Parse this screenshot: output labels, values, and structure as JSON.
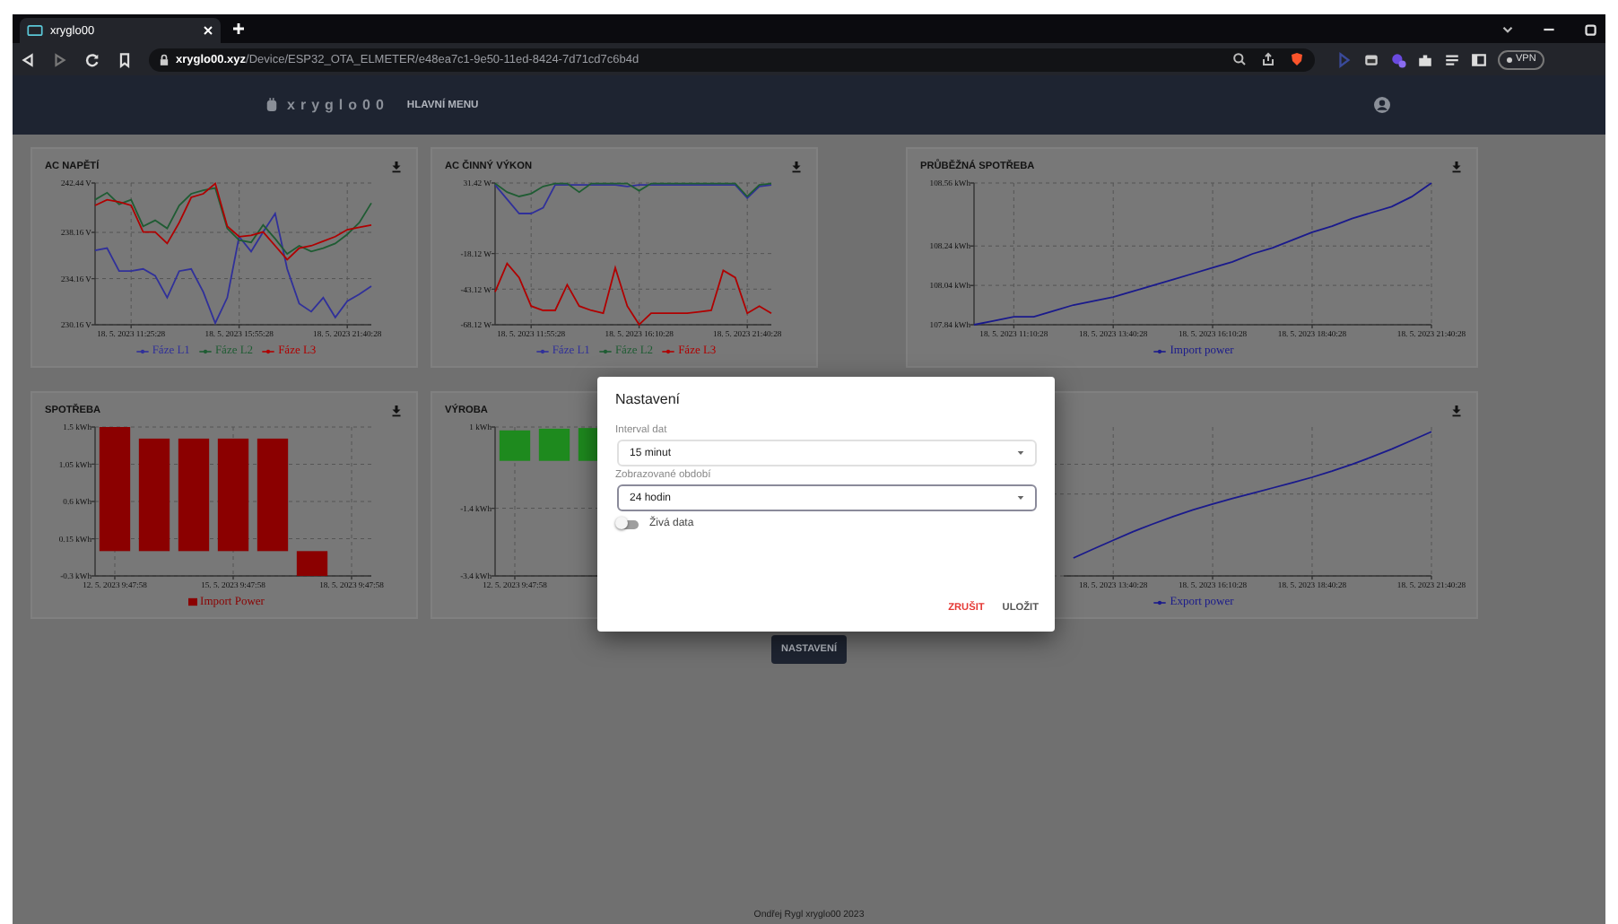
{
  "browser": {
    "tab_title": "xryglo00",
    "url_domain": "xryglo00.xyz",
    "url_path": "/Device/ESP32_OTA_ELMETER/e48ea7c1-9e50-11ed-8424-7d71cd7c6b4d",
    "vpn_label": "VPN"
  },
  "header": {
    "brand": "xryglo00",
    "menu": "HLAVNÍ MENU"
  },
  "cards": [
    {
      "title": "AC NAPĚTÍ",
      "download": true,
      "chart_data": {
        "type": "line",
        "grid": true,
        "ylim": [
          230.16,
          242.44
        ],
        "categories": [
          null,
          null,
          null,
          "18. 5. 2023 11:25:28",
          null,
          null,
          null,
          null,
          null,
          null,
          null,
          null,
          "18. 5. 2023 15:55:28",
          null,
          null,
          null,
          null,
          null,
          null,
          null,
          null,
          "18. 5. 2023 21:40:28",
          null,
          null
        ],
        "yticks": [
          {
            "value": 230.16,
            "label": "230.16 V"
          },
          {
            "value": 234.16,
            "label": "234.16 V"
          },
          {
            "value": 238.16,
            "label": "238.16 V"
          },
          {
            "value": 242.44,
            "label": "242.44 V"
          }
        ],
        "series": [
          {
            "name": "Fáze L1",
            "color": "#30309a",
            "values": [
              236.6,
              236.8,
              234.8,
              234.8,
              235,
              234.4,
              232.5,
              234.8,
              235,
              233,
              230.3,
              232.5,
              237.8,
              236.5,
              238.2,
              239.8,
              235,
              232,
              231.3,
              232.5,
              230.8,
              232.2,
              232.8,
              233.5
            ]
          },
          {
            "name": "Fáze L2",
            "color": "#1f5c33",
            "values": [
              241,
              241.6,
              240.6,
              241,
              238.7,
              239.2,
              238.5,
              240.5,
              241.5,
              241.8,
              242,
              238.5,
              237.5,
              237.3,
              238.8,
              237.6,
              236.3,
              237,
              236.5,
              236.8,
              237.2,
              238,
              239,
              240.7
            ]
          },
          {
            "name": "Fáze L3",
            "color": "#b00000",
            "values": [
              240.5,
              241,
              240.8,
              240.5,
              238.2,
              238.2,
              237.2,
              239,
              241.2,
              241.5,
              242.4,
              238.7,
              237.8,
              237.9,
              238.2,
              237,
              235.8,
              236.8,
              237,
              237.4,
              237.8,
              238.4,
              238.6,
              238.8
            ]
          }
        ]
      }
    },
    {
      "title": "AC ČINNÝ VÝKON",
      "download": true,
      "chart_data": {
        "type": "line",
        "grid": true,
        "ylim": [
          -68.12,
          31.42
        ],
        "categories": [
          null,
          null,
          null,
          "18. 5. 2023 11:55:28",
          null,
          null,
          null,
          null,
          null,
          null,
          null,
          null,
          "18. 5. 2023 16:10:28",
          null,
          null,
          null,
          null,
          null,
          null,
          null,
          null,
          "18. 5. 2023 21:40:28",
          null,
          null
        ],
        "yticks": [
          {
            "value": -68.12,
            "label": "-68.12 W"
          },
          {
            "value": -43.12,
            "label": "-43.12 W"
          },
          {
            "value": -18.12,
            "label": "-18.12 W"
          },
          {
            "value": 31.42,
            "label": "31.42 W"
          }
        ],
        "series": [
          {
            "name": "Fáze L1",
            "color": "#30309a",
            "values": [
              30,
              20,
              10,
              10,
              14,
              30,
              30,
              30,
              30,
              30,
              30,
              29,
              30,
              30,
              30,
              30,
              30,
              30,
              30,
              30,
              30,
              21,
              29,
              30
            ]
          },
          {
            "name": "Fáze L2",
            "color": "#1f5c33",
            "values": [
              31,
              25,
              22,
              24,
              29,
              31,
              31,
              25,
              31,
              31,
              31,
              31,
              26,
              31,
              31,
              31,
              31,
              31,
              31,
              31,
              31,
              22,
              30,
              31
            ]
          },
          {
            "name": "Fáze L3",
            "color": "#b00000",
            "values": [
              -45,
              -25,
              -35,
              -55,
              -58,
              -58,
              -40,
              -55,
              -58,
              -60,
              -28,
              -55,
              -68,
              -60,
              -60,
              -60,
              -60,
              -59,
              -58,
              -30,
              -35,
              -60,
              -55,
              -60
            ]
          }
        ]
      }
    },
    {
      "title": "PRŮBĚŽNÁ SPOTŘEBA",
      "download": true,
      "chart_data": {
        "type": "line",
        "grid": true,
        "ylim": [
          107.84,
          108.56
        ],
        "categories": [
          null,
          null,
          "18. 5. 2023 11:10:28",
          null,
          null,
          null,
          null,
          "18. 5. 2023 13:40:28",
          null,
          null,
          null,
          null,
          "18. 5. 2023 16:10:28",
          null,
          null,
          null,
          null,
          "18. 5. 2023 18:40:28",
          null,
          null,
          null,
          null,
          null,
          "18. 5. 2023 21:40:28"
        ],
        "yticks": [
          {
            "value": 107.84,
            "label": "107.84 kWh"
          },
          {
            "value": 108.04,
            "label": "108.04 kWh"
          },
          {
            "value": 108.24,
            "label": "108.24 kWh"
          },
          {
            "value": 108.56,
            "label": "108.56 kWh"
          }
        ],
        "series": [
          {
            "name": "Import power",
            "color": "#1a1a8c",
            "values": [
              107.84,
              107.86,
              107.88,
              107.88,
              107.91,
              107.94,
              107.96,
              107.98,
              108.01,
              108.04,
              108.07,
              108.1,
              108.13,
              108.16,
              108.2,
              108.23,
              108.27,
              108.31,
              108.34,
              108.38,
              108.41,
              108.44,
              108.49,
              108.56
            ]
          }
        ]
      }
    },
    {
      "title": "SPOTŘEBA",
      "download": true,
      "chart_data": {
        "type": "bar",
        "grid": true,
        "ylim": [
          -0.3,
          1.5
        ],
        "categories": [
          "12. 5. 2023 9:47:58",
          null,
          null,
          "15. 5. 2023 9:47:58",
          null,
          null,
          "18. 5. 2023 9:47:58"
        ],
        "yticks": [
          {
            "value": -0.3,
            "label": "-0.3 kWh"
          },
          {
            "value": 0.15,
            "label": "0.15 kWh"
          },
          {
            "value": 0.6,
            "label": "0.6 kWh"
          },
          {
            "value": 1.05,
            "label": "1.05 kWh"
          },
          {
            "value": 1.5,
            "label": "1.5 kWh"
          }
        ],
        "series": [
          {
            "name": "Import Power",
            "color": "#8b0000",
            "values": [
              1.5,
              1.36,
              1.36,
              1.36,
              1.36,
              -0.3,
              null
            ]
          }
        ]
      }
    },
    {
      "title": "VÝROBA",
      "chart_data": {
        "type": "bar",
        "grid": true,
        "ylim": [
          -3.4,
          1
        ],
        "categories": [
          "12. 5. 2023 9:47:58",
          null,
          null,
          null,
          null,
          null,
          null
        ],
        "yticks": [
          {
            "value": -3.4,
            "label": "-3.4 kWh"
          },
          {
            "value": -1.4,
            "label": "-1.4 kWh"
          },
          {
            "value": 1,
            "label": "1 kWh"
          }
        ],
        "series": [
          {
            "color": "#1e8a1e",
            "values": [
              0.9,
              0.95,
              0.97,
              null,
              null,
              null,
              null
            ]
          }
        ]
      }
    },
    {
      "download": true,
      "x_labels": [
        "18. 5. 2023 13:40:28",
        "18. 5. 2023 16:10:28",
        "18. 5. 2023 18:40:28",
        "18. 5. 2023 21:40:28"
      ],
      "legend": {
        "name": "Export power",
        "color": "#1a1a8c"
      }
    }
  ],
  "settings_button": "NASTAVENÍ",
  "footer": "Ondřej Rygl xryglo00 2023",
  "modal": {
    "title": "Nastavení",
    "selects": [
      {
        "label": "Interval dat",
        "value": "15 minut",
        "focused": false
      },
      {
        "label": "Zobrazované období",
        "value": "24 hodin",
        "focused": true
      }
    ],
    "live_data": {
      "label": "Živá data",
      "on": false
    },
    "cancel": "ZRUŠIT",
    "save": "ULOŽIT"
  }
}
